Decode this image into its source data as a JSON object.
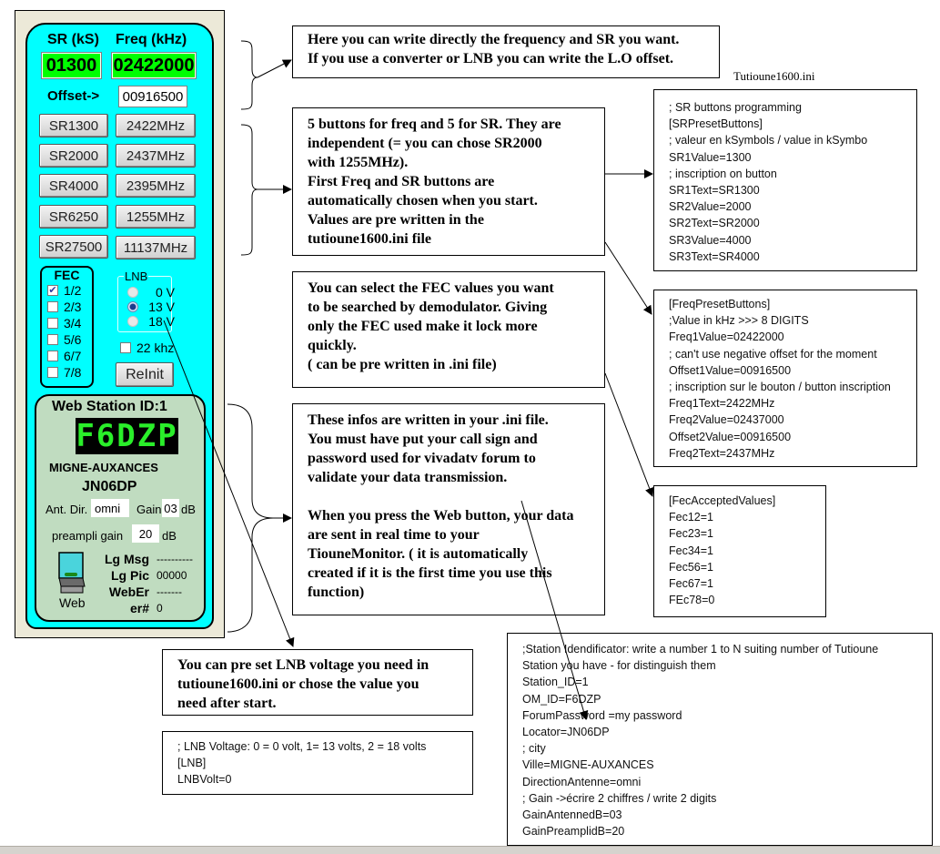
{
  "app": {
    "headers": {
      "sr": "SR (kS)",
      "freq": "Freq (kHz)"
    },
    "sr_value": "01300",
    "freq_value": "02422000",
    "offset_label": "Offset->",
    "offset_value": "00916500",
    "sr_buttons": [
      "SR1300",
      "SR2000",
      "SR4000",
      "SR6250",
      "SR27500"
    ],
    "freq_buttons": [
      "2422MHz",
      "2437MHz",
      "2395MHz",
      "1255MHz",
      "11137MHz"
    ],
    "fec": {
      "title": "FEC",
      "items": [
        {
          "label": "1/2",
          "checked": true
        },
        {
          "label": "2/3",
          "checked": false
        },
        {
          "label": "3/4",
          "checked": false
        },
        {
          "label": "5/6",
          "checked": false
        },
        {
          "label": "6/7",
          "checked": false
        },
        {
          "label": "7/8",
          "checked": false
        }
      ]
    },
    "lnb": {
      "title": "LNB",
      "options": [
        {
          "label": "0 V",
          "selected": false
        },
        {
          "label": "13 V",
          "selected": true
        },
        {
          "label": "18 V",
          "selected": false
        }
      ]
    },
    "tone_22khz": {
      "label": "22 khz",
      "checked": false
    },
    "reinit_label": "ReInit",
    "web": {
      "title": "Web Station ID:1",
      "callsign_display": "F6DZP",
      "city": "MIGNE-AUXANCES",
      "locator": "JN06DP",
      "ant_dir_label": "Ant. Dir.",
      "ant_dir_value": "omni",
      "gain_label": "Gain",
      "gain_value": "03",
      "gain_unit": "dB",
      "preampli_label": "preampli gain",
      "preampli_value": "20",
      "preampli_unit": "dB",
      "web_button_label": "Web",
      "stats": [
        {
          "label": "Lg Msg",
          "value": "----------"
        },
        {
          "label": "Lg Pic",
          "value": "00000"
        },
        {
          "label": "WebEr",
          "value": "-------"
        },
        {
          "label": "er#",
          "value": "0"
        }
      ]
    }
  },
  "annotations": {
    "freq_sr": [
      "Here you can write directly the frequency and SR you want.",
      "If you use a converter or LNB you can write the L.O offset."
    ],
    "buttons": [
      "5 buttons for freq and 5 for SR. They are",
      "independent (= you can chose SR2000",
      "with 1255MHz).",
      "First Freq and SR buttons are",
      "automatically chosen when you start.",
      "Values are pre written in the",
      "tutioune1600.ini file"
    ],
    "fec": [
      "You can select the FEC  values you want",
      "to be searched by demodulator. Giving",
      "only the FEC used make it lock more",
      "quickly.",
      "( can be pre written in .ini file)"
    ],
    "web": [
      "These  infos are written in your .ini file.",
      "You must have put your call sign and",
      "password used for vivadatv forum to",
      "validate your data transmission.",
      "",
      "When you press the Web button, your data",
      "are sent in real time to your",
      "TiouneMonitor. ( it is automatically",
      "created if it is the first time you use this",
      "function)"
    ],
    "lnb": [
      "You can pre set LNB voltage you need in",
      "tutioune1600.ini or chose the value you",
      "need after start."
    ]
  },
  "ini_caption": "Tutioune1600.ini",
  "ini_blocks": {
    "sr_preset": [
      "; SR buttons programming",
      "[SRPresetButtons]",
      "; valeur en kSymbols / value in kSymbo",
      "SR1Value=1300",
      "; inscription on button",
      "SR1Text=SR1300",
      "SR2Value=2000",
      "SR2Text=SR2000",
      "SR3Value=4000",
      "SR3Text=SR4000"
    ],
    "freq_preset": [
      "[FreqPresetButtons]",
      ";Value in kHz >>>  8 DIGITS",
      "Freq1Value=02422000",
      "; can't use negative offset for the moment",
      "Offset1Value=00916500",
      "; inscription sur le bouton / button inscription",
      "Freq1Text=2422MHz",
      "Freq2Value=02437000",
      "Offset2Value=00916500",
      "Freq2Text=2437MHz"
    ],
    "fec_accepted": [
      "[FecAcceptedValues]",
      "Fec12=1",
      "Fec23=1",
      "Fec34=1",
      "Fec56=1",
      "Fec67=1",
      "FEc78=0"
    ],
    "lnb": [
      "; LNB Voltage:  0 = 0 volt, 1= 13 volts, 2 = 18 volts",
      "[LNB]",
      "LNBVolt=0"
    ],
    "station": [
      ";Station Idendificator: write a number 1 to N suiting number of Tutioune",
      "Station you have - for distinguish them",
      "Station_ID=1",
      "OM_ID=F6DZP",
      "ForumPassword =my password",
      "Locator=JN06DP",
      "; city",
      "Ville=MIGNE-AUXANCES",
      "DirectionAntenne=omni",
      "; Gain ->écrire 2 chiffres /  write 2 digits",
      "GainAntennedB=03",
      "GainPreamplidB=20"
    ]
  }
}
